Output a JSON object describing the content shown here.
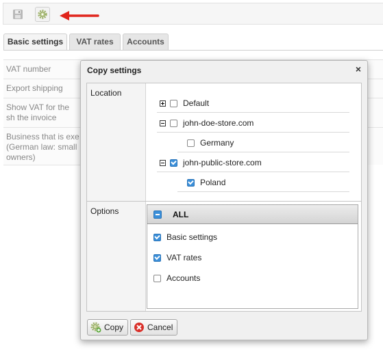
{
  "tabs": [
    {
      "label": "Basic settings",
      "active": true
    },
    {
      "label": "VAT rates",
      "active": false
    },
    {
      "label": "Accounts",
      "active": false
    }
  ],
  "background_rows": [
    "VAT number",
    "Export shipping",
    "Show VAT for the sh the invoice",
    "Business that is exe (German law: small owners)"
  ],
  "dialog": {
    "title": "Copy settings",
    "close": "×",
    "location_label": "Location",
    "options_label": "Options",
    "tree": [
      {
        "label": "Default",
        "expander": "plus",
        "checked": false
      },
      {
        "label": "john-doe-store.com",
        "expander": "minus",
        "checked": false
      },
      {
        "label": "Germany",
        "expander": "none",
        "checked": false
      },
      {
        "label": "john-public-store.com",
        "expander": "minus",
        "checked": true
      },
      {
        "label": "Poland",
        "expander": "none",
        "checked": true
      }
    ],
    "options_all": "ALL",
    "options": [
      {
        "label": "Basic settings",
        "checked": true
      },
      {
        "label": "VAT rates",
        "checked": true
      },
      {
        "label": "Accounts",
        "checked": false
      }
    ],
    "copy_button": "Copy",
    "cancel_button": "Cancel"
  },
  "colors": {
    "accent": "#3b8fd9",
    "arrow": "#e0241b"
  }
}
